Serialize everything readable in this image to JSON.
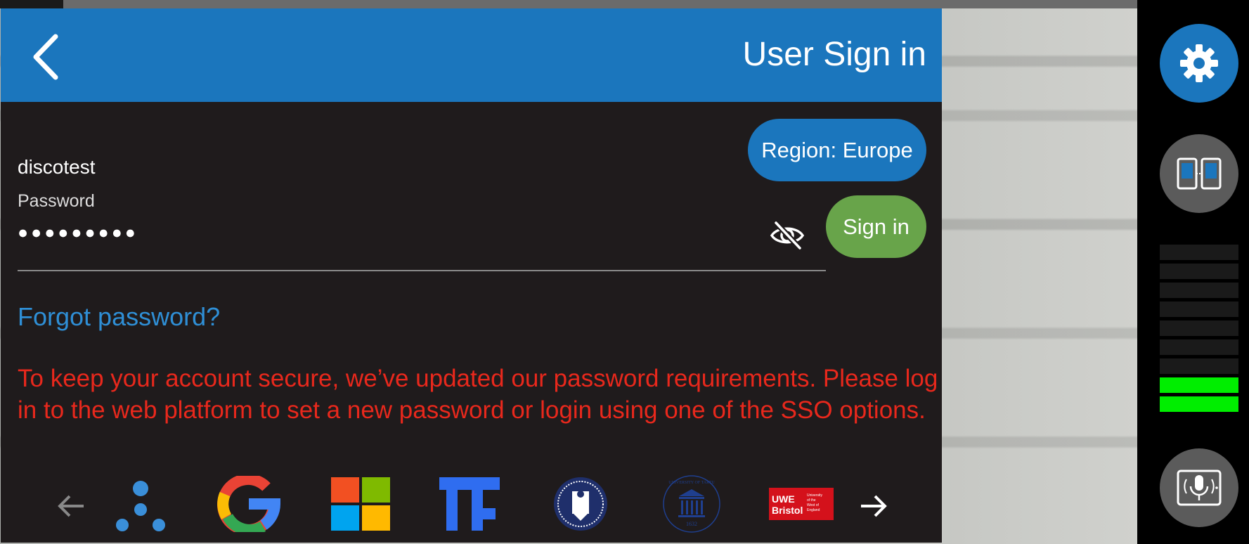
{
  "header": {
    "title": "User Sign in",
    "back_icon": "chevron-left-icon"
  },
  "form": {
    "username": "discotest",
    "password_label": "Password",
    "password_mask": "●●●●●●●●●",
    "region_label": "Region: Europe",
    "signin_label": "Sign in",
    "forgot_label": "Forgot password?",
    "visibility_icon": "eye-off-icon"
  },
  "warning": "To keep your account secure, we’ve updated our password requirements. Please log in to the web platform to set a new password or login using one of the SSO options.",
  "sso": {
    "prev_icon": "arrow-left-icon",
    "next_icon": "arrow-right-icon",
    "providers": [
      {
        "name": "triangle-dots-logo"
      },
      {
        "name": "google-logo"
      },
      {
        "name": "microsoft-logo"
      },
      {
        "name": "tf-logo"
      },
      {
        "name": "university-seal-logo"
      },
      {
        "name": "university-of-tartu-logo",
        "text": "UNIVERSITY OF TARTU",
        "year": "1632"
      },
      {
        "name": "uwe-bristol-logo",
        "text": "UWE Bristol",
        "subtext": "University of the West of England"
      }
    ]
  },
  "sidebar": {
    "settings_icon": "gear-icon",
    "devices_icon": "dual-device-icon",
    "mic_icon": "microphone-tablet-icon",
    "level_meter": {
      "segments": 9,
      "active": 2
    }
  },
  "colors": {
    "header_blue": "#1b76bd",
    "signin_green": "#68a44a",
    "warning_red": "#e8281c",
    "link_blue": "#2f8fd6",
    "meter_green": "#00ee00"
  }
}
